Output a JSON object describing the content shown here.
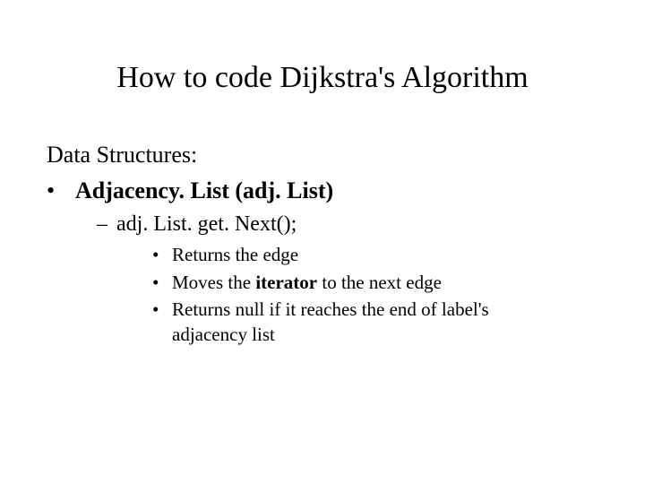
{
  "title": "How to code Dijkstra's Algorithm",
  "heading": "Data Structures:",
  "item1_label": "Adjacency. List (adj. List)",
  "item2_label": "adj. List. get. Next();",
  "sub1": "Returns the edge",
  "sub2_prefix": "Moves the ",
  "sub2_bold": "iterator",
  "sub2_suffix": " to the next edge",
  "sub3": "Returns null if it reaches the end of label's adjacency list",
  "bullet": "•",
  "dash": "–"
}
